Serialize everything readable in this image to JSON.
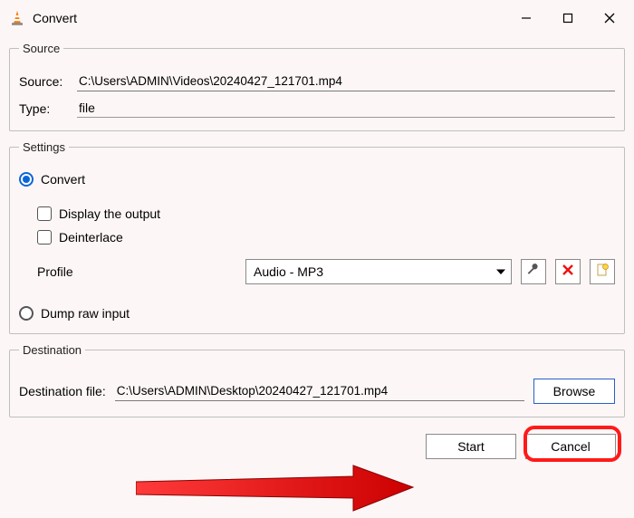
{
  "window": {
    "title": "Convert"
  },
  "source": {
    "legend": "Source",
    "source_label": "Source:",
    "source_value": "C:\\Users\\ADMIN\\Videos\\20240427_121701.mp4",
    "type_label": "Type:",
    "type_value": "file"
  },
  "settings": {
    "legend": "Settings",
    "convert_label": "Convert",
    "display_output_label": "Display the output",
    "deinterlace_label": "Deinterlace",
    "profile_label": "Profile",
    "profile_value": "Audio - MP3",
    "dump_label": "Dump raw input"
  },
  "destination": {
    "legend": "Destination",
    "file_label": "Destination file:",
    "file_value": "C:\\Users\\ADMIN\\Desktop\\20240427_121701.mp4",
    "browse_label": "Browse"
  },
  "buttons": {
    "start": "Start",
    "cancel": "Cancel"
  }
}
